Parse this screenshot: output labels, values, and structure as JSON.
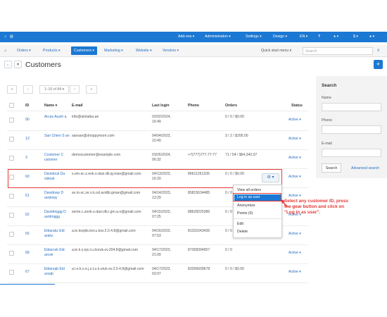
{
  "topbar": {
    "addons": "Add-ons ▾",
    "administration": "Administration ▾",
    "settings": "Settings ▾",
    "design": "Design ▾",
    "lang": "EN ▾",
    "help": "?",
    "notifications": "▾",
    "currency": "$ ▾",
    "account": "▾"
  },
  "menu": {
    "items": [
      "Orders ▾",
      "Products ▾",
      "Customers ▾",
      "Marketing ▾",
      "Website ▾",
      "Vendors ▾"
    ],
    "quick_start": "Quick start menu ▾",
    "search_placeholder": "Search"
  },
  "page": {
    "title": "Customers",
    "pagination": "1–10 of 84 ▾"
  },
  "table": {
    "headers": [
      "ID",
      "Name ▾",
      "E-mail",
      "Last login",
      "Phone",
      "Orders",
      "Status"
    ],
    "rows": [
      {
        "id": "90",
        "name": "Arcas Austri a",
        "email": "info@alotaiba.ae",
        "login": "02/02/2024, 16:49",
        "phone": "",
        "orders": "0 / 0 / $0.00",
        "status": "Active ▾"
      },
      {
        "id": "13",
        "name": "San Chien S an",
        "email": "sansan@shoppymore.com",
        "login": "04/04/2023, 10:49",
        "phone": "",
        "orders": "3 / 2 / $205.00",
        "status": "Active ▾"
      },
      {
        "id": "3",
        "name": "Customer C ustomer",
        "email": "democustomer@example.com",
        "login": "03/26/2024, 06:32",
        "phone": "+7(777)777-77-77",
        "orders": "71 / 54 / $64,342.07",
        "status": "Active ▾"
      },
      {
        "id": "60",
        "name": "Davidouk Da vidouk",
        "email": "s.em.ec.z.enk.o.davi.db.ig.man@gmail.com",
        "login": "04/13/2023, 16:20",
        "phone": "86611261335",
        "orders": "0 / 0 / $0.00",
        "status": "Active ▾"
      },
      {
        "id": "61",
        "name": "Davidowy D avidowy",
        "email": "se.m.ec.ze.n.k.od.avidbi.gman@gmail.com",
        "login": "04/14/2023, 13:29",
        "phone": "85815634485",
        "orders": "0 / 0",
        "status": "Active ▾"
      },
      {
        "id": "62",
        "name": "Davidmggg D avidmggg",
        "email": "seme.c.zenk.o.davi.db.i.gm.a.n@gmail.com",
        "login": "04/15/2023, 07:25",
        "phone": "88628225386",
        "orders": "0 / 0",
        "status": "Active ▾"
      },
      {
        "id": "65",
        "name": "Eldarakz Eld arakz",
        "email": "a.le.ksejits.kor.u.kov.2.0.4.8@gmail.com",
        "login": "04/16/2023, 07:53",
        "phone": "81331543436",
        "orders": "0 / 0",
        "status": "Active ▾"
      },
      {
        "id": "68",
        "name": "Eldarcek Eld arcek",
        "email": "a.le.k.s.ejs.t.u.koruk.ov.204.8@gmail.com",
        "login": "04/17/2023, 21:09",
        "phone": "87358394957",
        "orders": "0 / 0",
        "status": "Active ▾"
      },
      {
        "id": "67",
        "name": "Eldarsqb Eld arsqb",
        "email": "a.l.e.k.s.e.j.s.t.u.k.oruk.ov.2.0.4.8@gmail.com",
        "login": "04/17/2023, 03:07",
        "phone": "83266609678",
        "orders": "0 / 0 / $0.00",
        "status": "Active ▾"
      }
    ]
  },
  "dropdown": {
    "items": [
      "View all orders",
      "Log in as user",
      "Anonymize",
      "Points (0)",
      "Edit",
      "Delete"
    ]
  },
  "callout": "Select any customer ID, press the gear button and click on \"Log in as user\".",
  "sidebar": {
    "title": "Search",
    "name_label": "Name",
    "phone_label": "Phone",
    "email_label": "E-mail",
    "search_button": "Search",
    "advanced_link": "Advanced search"
  },
  "colors": {
    "accent": "#1b78d3",
    "highlight": "#e53935",
    "link": "#2a6fbf"
  }
}
